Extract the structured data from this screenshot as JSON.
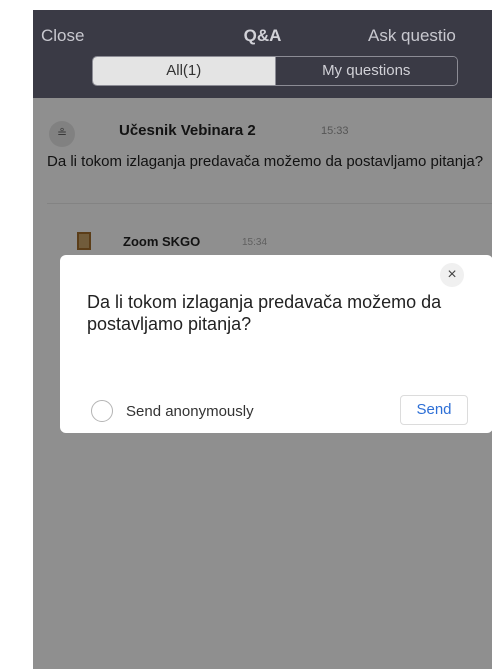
{
  "header": {
    "close_label": "Close",
    "title": "Q&A",
    "ask_label": "Ask questio",
    "tabs": [
      {
        "label": "All(1)",
        "selected": true
      },
      {
        "label": "My questions",
        "selected": false
      }
    ]
  },
  "question": {
    "avatar_glyph": "≗",
    "author": "Učesnik Vebinara 2",
    "time": "15:33",
    "text": "Da li tokom izlaganja predavača možemo da postavljamo pitanja?"
  },
  "answer": {
    "author": "Zoom SKGO",
    "time": "15:34"
  },
  "dialog": {
    "close_glyph": "×",
    "question_text": "Da li tokom izlaganja predavača možemo da postavljamo pitanja?",
    "anonymous_label": "Send anonymously",
    "anonymous_checked": false,
    "send_label": "Send"
  },
  "colors": {
    "header_bg": "#3a3a45",
    "accent": "#2d6fd6"
  }
}
